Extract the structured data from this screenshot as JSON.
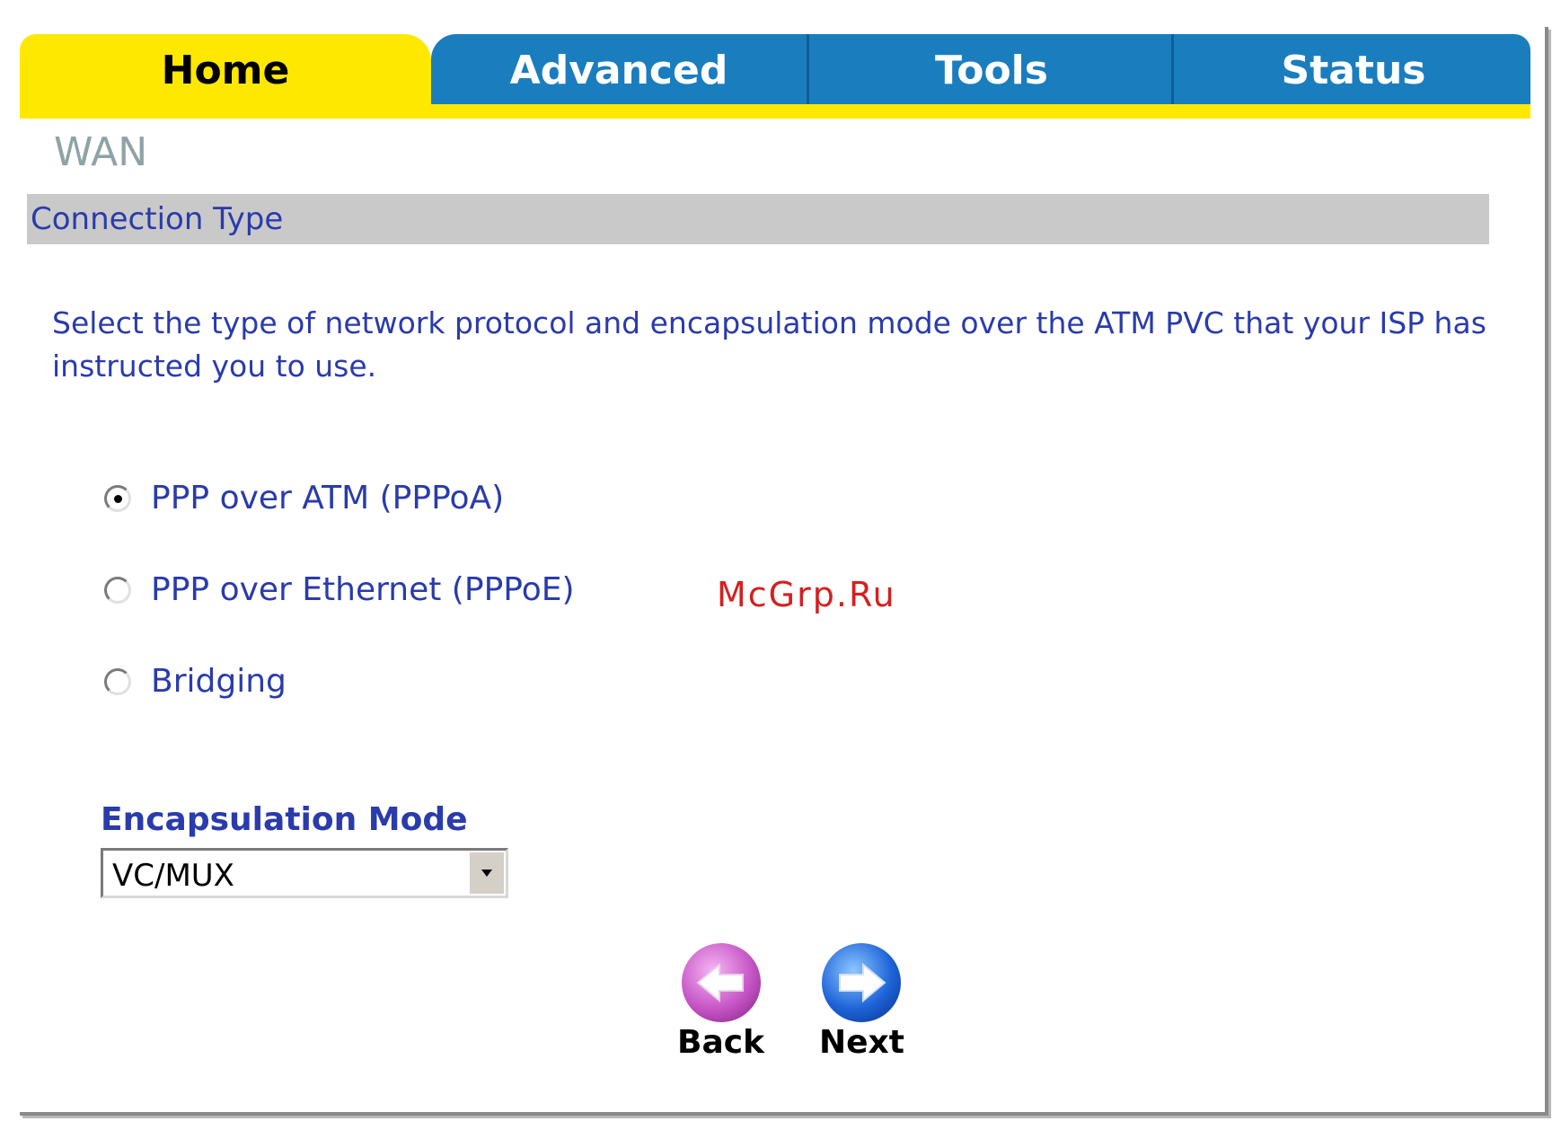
{
  "tabs": [
    {
      "label": "Home",
      "active": true
    },
    {
      "label": "Advanced",
      "active": false
    },
    {
      "label": "Tools",
      "active": false
    },
    {
      "label": "Status",
      "active": false
    }
  ],
  "page_title": "WAN",
  "section_title": "Connection Type",
  "description": "Select the type of network protocol and encapsulation mode over the ATM PVC that your ISP has instructed you to use.",
  "connection_options": [
    {
      "label": "PPP over ATM (PPPoA)",
      "checked": true
    },
    {
      "label": "PPP over Ethernet (PPPoE)",
      "checked": false
    },
    {
      "label": "Bridging",
      "checked": false
    }
  ],
  "encapsulation": {
    "label": "Encapsulation Mode",
    "selected": "VC/MUX"
  },
  "buttons": {
    "back_label": "Back",
    "next_label": "Next"
  },
  "watermark": "McGrp.Ru",
  "colors": {
    "tab_active": "#ffe800",
    "tab_inactive": "#1a7dbe",
    "text_blue": "#2a3bab",
    "section_bar": "#c9c9c9"
  }
}
